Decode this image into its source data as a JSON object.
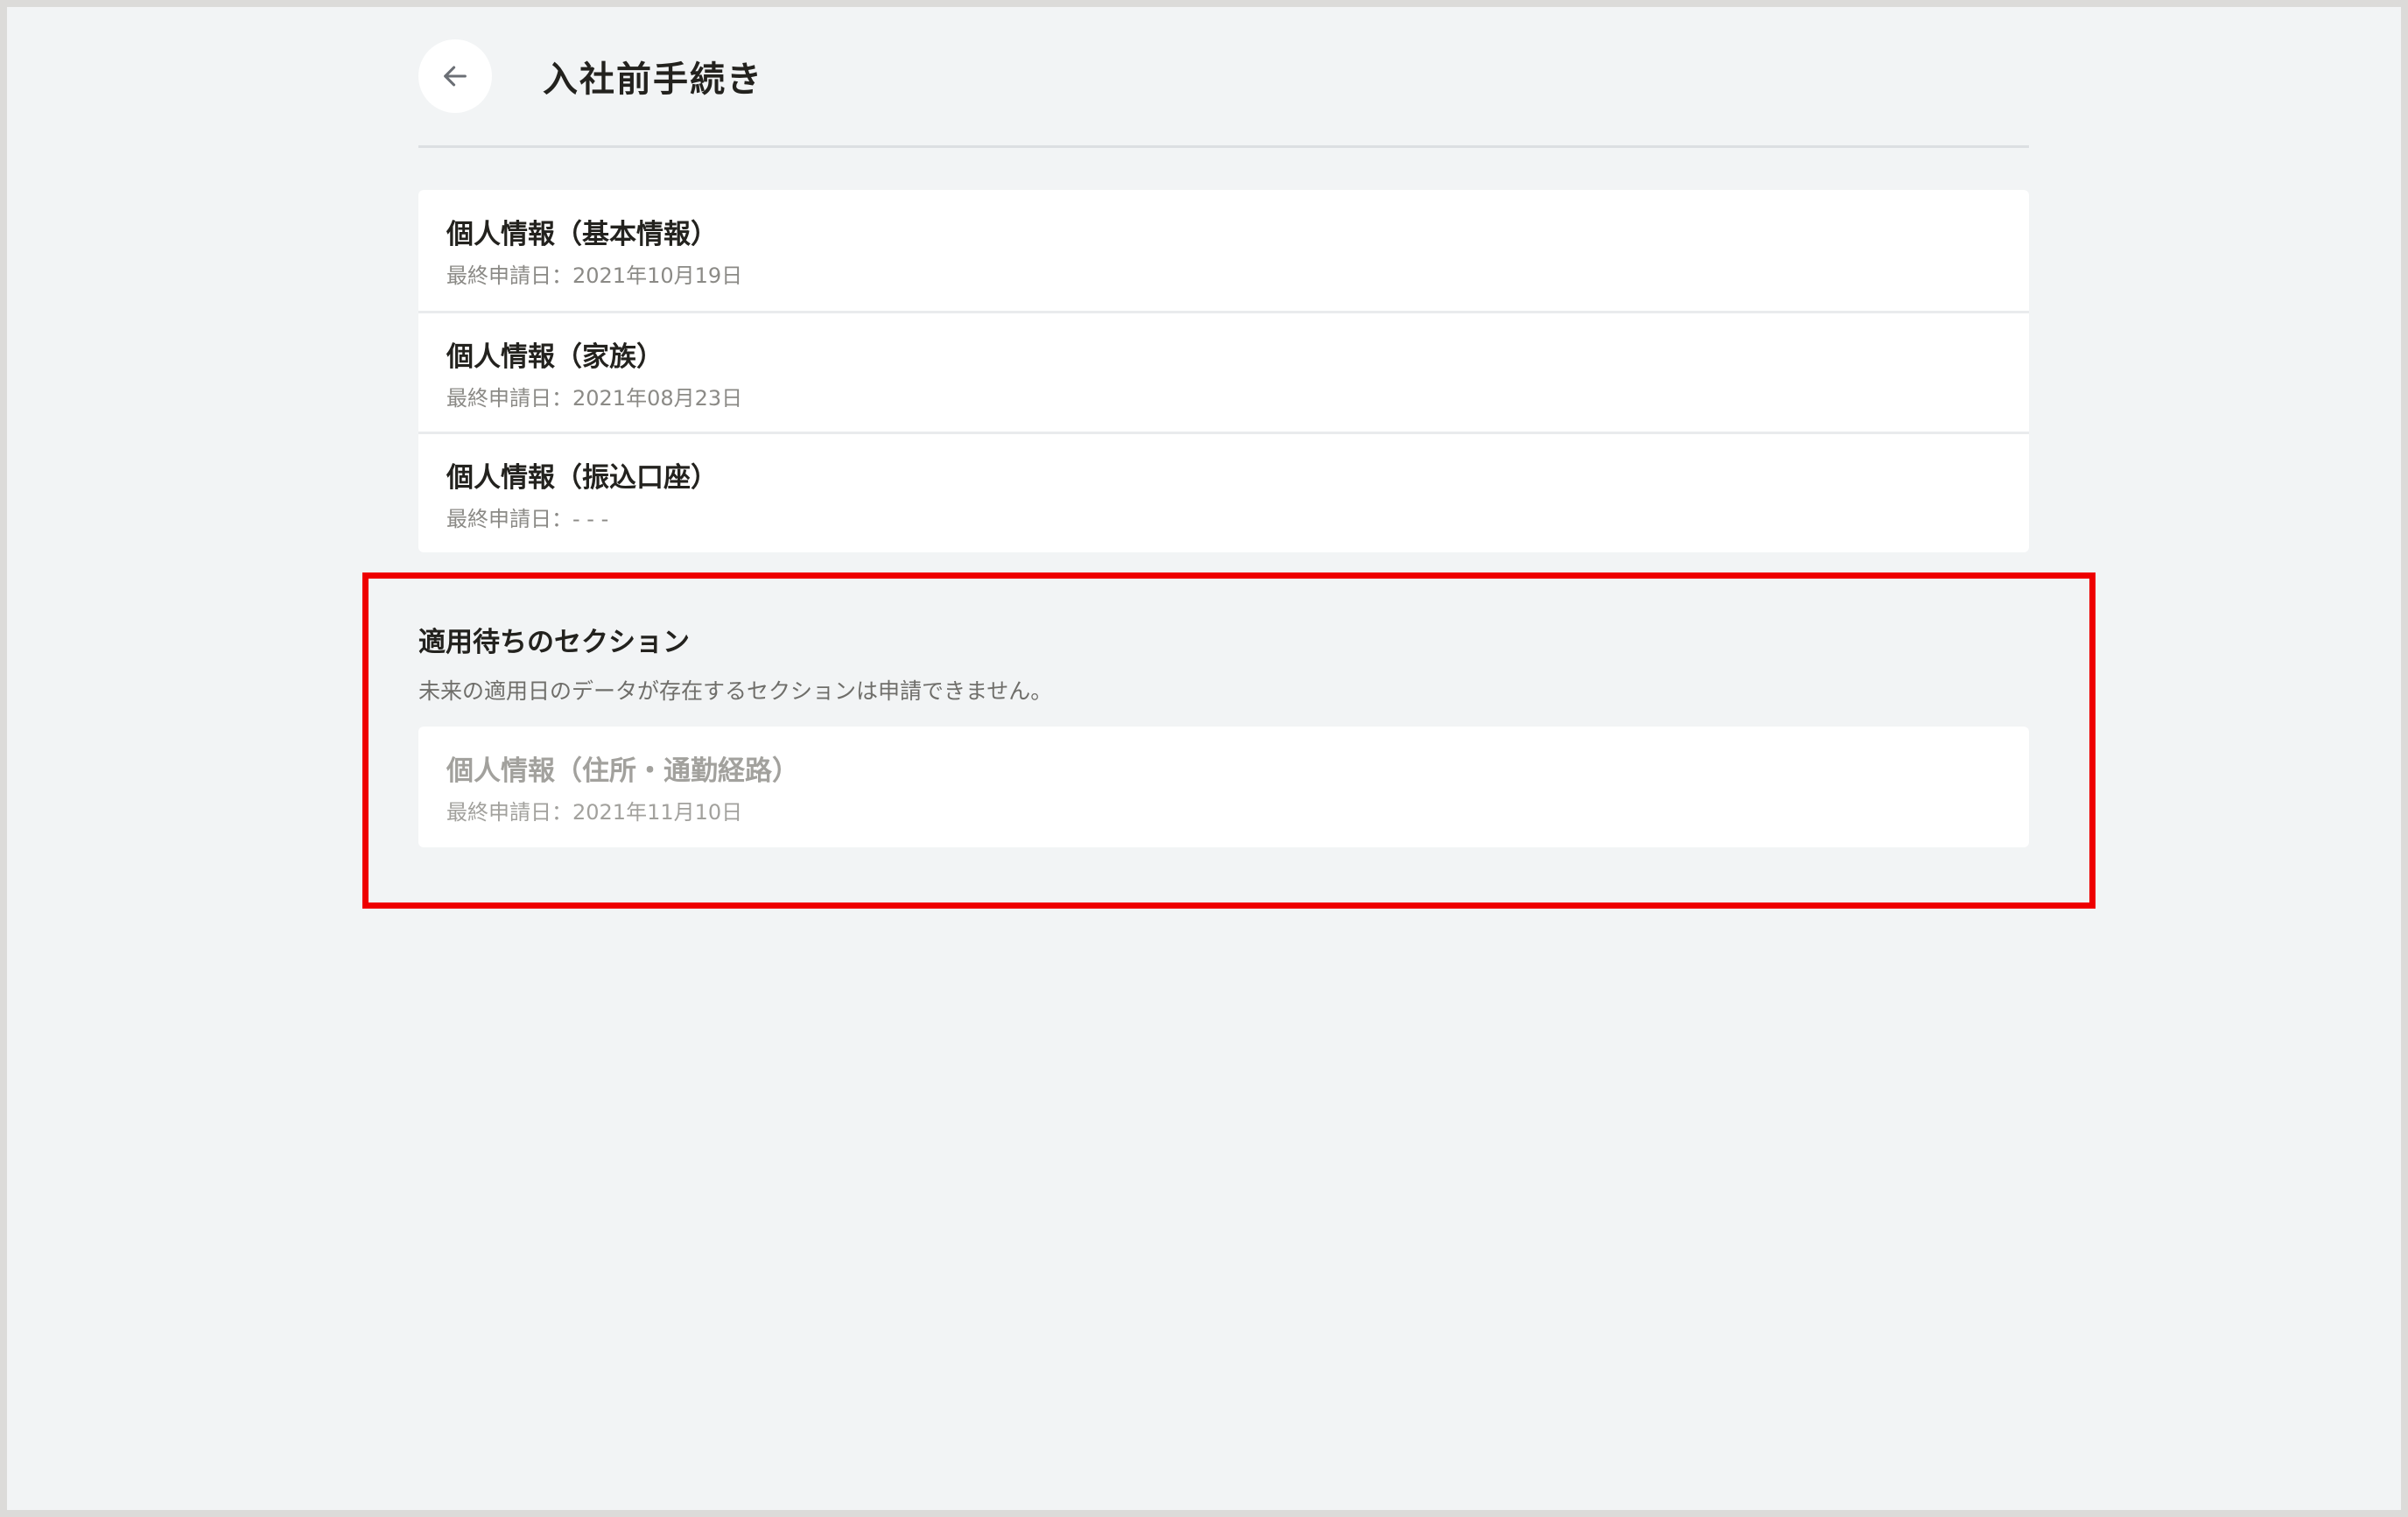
{
  "header": {
    "title": "入社前手続き",
    "back_icon": "arrow-left-icon"
  },
  "sections": [
    {
      "title": "個人情報（基本情報）",
      "subtitle": "最終申請日：2021年10月19日"
    },
    {
      "title": "個人情報（家族）",
      "subtitle": "最終申請日：2021年08月23日"
    },
    {
      "title": "個人情報（振込口座）",
      "subtitle": "最終申請日：- - -"
    }
  ],
  "pending": {
    "title": "適用待ちのセクション",
    "description": "未来の適用日のデータが存在するセクションは申請できません。",
    "items": [
      {
        "title": "個人情報（住所・通勤経路）",
        "subtitle": "最終申請日：2021年11月10日"
      }
    ]
  },
  "colors": {
    "background": "#f2f4f5",
    "card": "#ffffff",
    "highlight": "#ee0000",
    "text_primary": "#23221e",
    "text_muted": "#8b8a86",
    "text_disabled": "#a2a19d"
  }
}
